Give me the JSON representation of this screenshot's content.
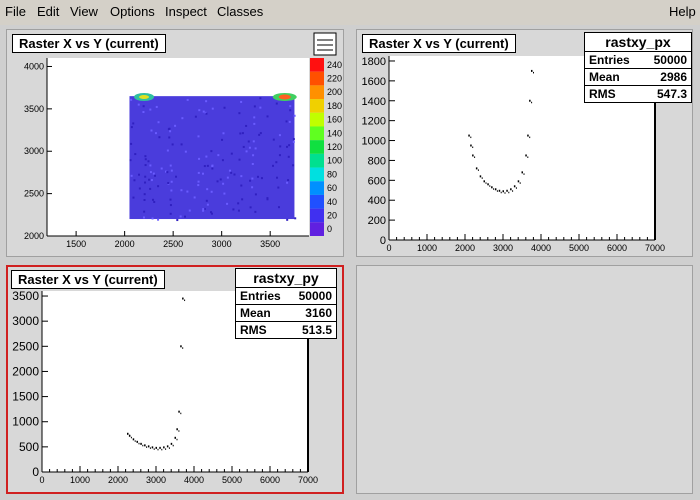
{
  "menu": {
    "file": "File",
    "edit": "Edit",
    "view": "View",
    "options": "Options",
    "inspect": "Inspect",
    "classes": "Classes",
    "help": "Help"
  },
  "pads": [
    {
      "title": "Raster X vs Y (current)",
      "xticks": [
        "1500",
        "2000",
        "2500",
        "3000",
        "3500"
      ],
      "yticks": [
        "4000",
        "3500",
        "3000",
        "2500",
        "2000"
      ],
      "zticks": [
        "240",
        "220",
        "200",
        "180",
        "160",
        "140",
        "120",
        "100",
        "80",
        "60",
        "40",
        "20",
        "0"
      ]
    },
    {
      "title": "Raster X vs Y (current)",
      "stats": {
        "name": "rastxy_px",
        "entries_label": "Entries",
        "entries": "50000",
        "mean_label": "Mean",
        "mean": "2986",
        "rms_label": "RMS",
        "rms": "547.3"
      },
      "xticks": [
        "0",
        "1000",
        "2000",
        "3000",
        "4000",
        "5000",
        "6000",
        "7000"
      ],
      "yticks": [
        "1800",
        "1600",
        "1400",
        "1200",
        "1000",
        "800",
        "600",
        "400",
        "200",
        "0"
      ]
    },
    {
      "title": "Raster X vs Y (current)",
      "stats": {
        "name": "rastxy_py",
        "entries_label": "Entries",
        "entries": "50000",
        "mean_label": "Mean",
        "mean": "3160",
        "rms_label": "RMS",
        "rms": "513.5"
      },
      "xticks": [
        "0",
        "1000",
        "2000",
        "3000",
        "4000",
        "5000",
        "6000",
        "7000"
      ],
      "yticks": [
        "3500",
        "3000",
        "2500",
        "2000",
        "1500",
        "1000",
        "500",
        "0"
      ]
    }
  ],
  "colors": {
    "selected_border": "#d02020",
    "axis": "#000000"
  },
  "chart_data": [
    {
      "type": "heatmap",
      "title": "Raster X vs Y (current)",
      "xlim": [
        1200,
        3900
      ],
      "ylim": [
        2000,
        4100
      ],
      "zlim": [
        0,
        250
      ],
      "description_regions": [
        {
          "x": [
            2050,
            3750
          ],
          "y": [
            2200,
            3650
          ],
          "z": 15
        },
        {
          "x": [
            2100,
            2300
          ],
          "y": [
            3580,
            3700
          ],
          "z": 150
        },
        {
          "x": [
            3550,
            3750
          ],
          "y": [
            3580,
            3700
          ],
          "z": 220
        }
      ]
    },
    {
      "type": "scatter",
      "title": "Raster X vs Y (current)",
      "series_name": "rastxy_px",
      "xlim": [
        0,
        7000
      ],
      "ylim": [
        0,
        1850
      ],
      "x": [
        2100,
        2150,
        2200,
        2300,
        2400,
        2500,
        2600,
        2700,
        2800,
        2900,
        3000,
        3100,
        3200,
        3300,
        3400,
        3500,
        3600,
        3650,
        3700,
        3750
      ],
      "y": [
        1050,
        950,
        850,
        720,
        640,
        590,
        560,
        530,
        510,
        495,
        490,
        495,
        510,
        540,
        590,
        680,
        850,
        1050,
        1400,
        1700
      ]
    },
    {
      "type": "scatter",
      "title": "Raster X vs Y (current)",
      "series_name": "rastxy_py",
      "xlim": [
        0,
        7000
      ],
      "ylim": [
        0,
        3600
      ],
      "x": [
        2250,
        2300,
        2400,
        2500,
        2600,
        2700,
        2800,
        2900,
        3000,
        3100,
        3200,
        3300,
        3400,
        3500,
        3550,
        3600,
        3650,
        3700
      ],
      "y": [
        760,
        720,
        650,
        600,
        560,
        530,
        510,
        490,
        480,
        480,
        490,
        510,
        560,
        680,
        850,
        1200,
        2500,
        3450
      ]
    }
  ]
}
